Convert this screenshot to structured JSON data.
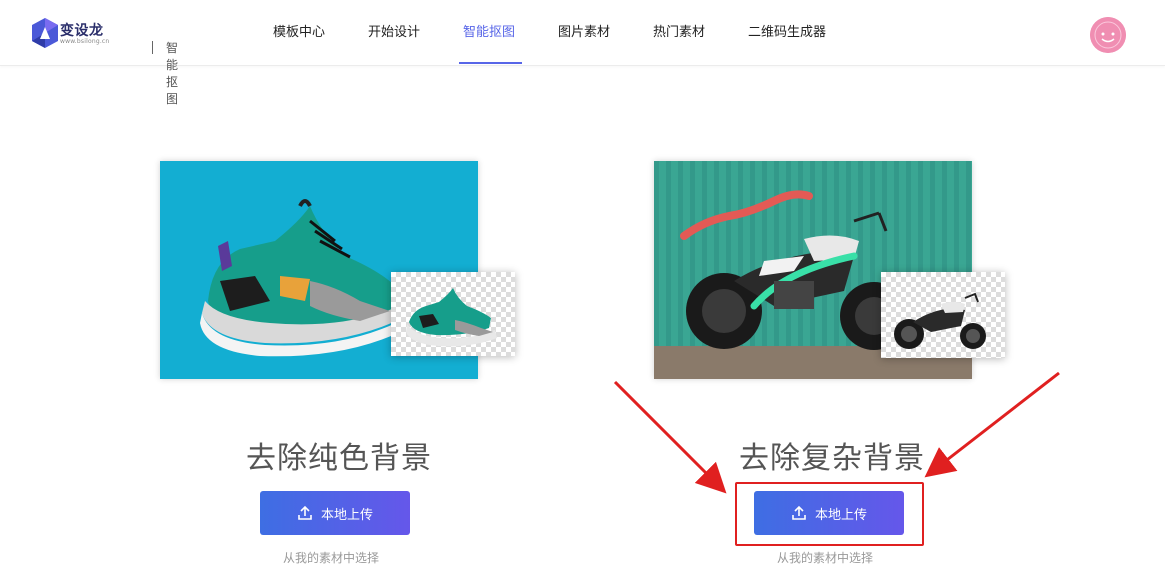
{
  "header": {
    "logo_name": "变设龙",
    "logo_domain": "www.bsilong.cn",
    "logo_sub": "智能抠图",
    "nav": [
      {
        "label": "模板中心"
      },
      {
        "label": "开始设计"
      },
      {
        "label": "智能抠图",
        "active": true
      },
      {
        "label": "图片素材"
      },
      {
        "label": "热门素材"
      },
      {
        "label": "二维码生成器"
      }
    ]
  },
  "cards": [
    {
      "title": "去除纯色背景",
      "button_label": "本地上传",
      "subtext": "从我的素材中选择"
    },
    {
      "title": "去除复杂背景",
      "button_label": "本地上传",
      "subtext": "从我的素材中选择"
    }
  ],
  "colors": {
    "accent": "#5866e8",
    "button_gradient_start": "#3e6ee3",
    "button_gradient_end": "#6557ea",
    "highlight_red": "#e02020"
  },
  "icons": {
    "upload": "upload-icon",
    "avatar": "smiley-avatar"
  }
}
